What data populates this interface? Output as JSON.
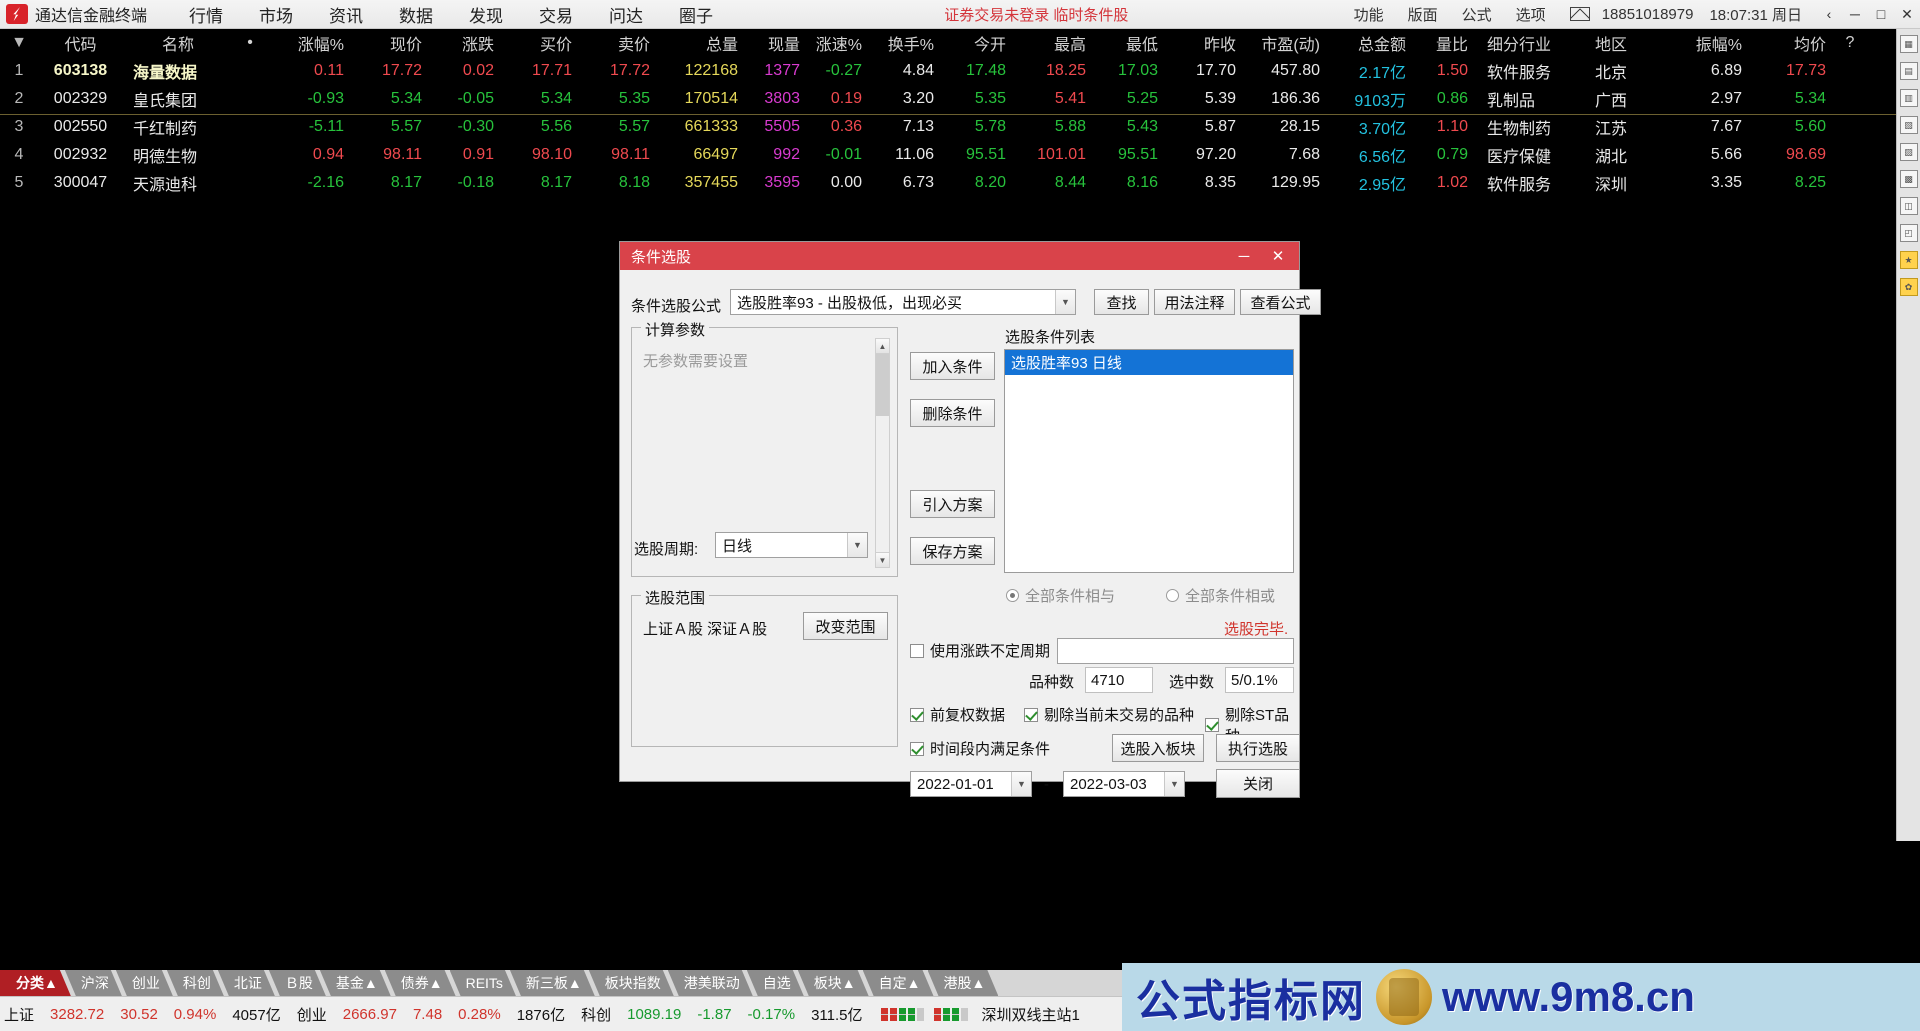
{
  "topbar": {
    "brand": "通达信金融终端",
    "menus": [
      "行情",
      "市场",
      "资讯",
      "数据",
      "发现",
      "交易",
      "问达",
      "圈子"
    ],
    "login_status": "证券交易未登录 临时条件股",
    "right_menus": [
      "功能",
      "版面",
      "公式",
      "选项"
    ],
    "mail_icon": "mail-icon",
    "phone": "18851018979",
    "clock": "18:07:31 周日",
    "win_prev": "‹",
    "win_min": "─",
    "win_max": "□",
    "win_close": "✕"
  },
  "table": {
    "columns": [
      "▼",
      "代码",
      "名称",
      "•",
      "涨幅%",
      "现价",
      "涨跌",
      "买价",
      "卖价",
      "总量",
      "现量",
      "涨速%",
      "换手%",
      "今开",
      "最高",
      "最低",
      "昨收",
      "市盈(动)",
      "总金额",
      "量比",
      "细分行业",
      "地区",
      "振幅%",
      "均价",
      "?"
    ],
    "rows": [
      {
        "idx": "1",
        "code": "603138",
        "name": "海量数据",
        "dot": "",
        "chg": "0.11",
        "price": "17.72",
        "delta": "0.02",
        "buy": "17.71",
        "sell": "17.72",
        "vol": "122168",
        "now": "1377",
        "spd": "-0.27",
        "turn": "4.84",
        "open": "17.48",
        "high": "18.25",
        "low": "17.03",
        "close": "17.70",
        "pe": "457.80",
        "amt": "2.17亿",
        "ratio": "1.50",
        "ind": "软件服务",
        "reg": "北京",
        "amp": "6.89",
        "avg": "17.73"
      },
      {
        "idx": "2",
        "code": "002329",
        "name": "皇氏集团",
        "dot": "",
        "chg": "-0.93",
        "price": "5.34",
        "delta": "-0.05",
        "buy": "5.34",
        "sell": "5.35",
        "vol": "170514",
        "now": "3803",
        "spd": "0.19",
        "turn": "3.20",
        "open": "5.35",
        "high": "5.41",
        "low": "5.25",
        "close": "5.39",
        "pe": "186.36",
        "amt": "9103万",
        "ratio": "0.86",
        "ind": "乳制品",
        "reg": "广西",
        "amp": "2.97",
        "avg": "5.34"
      },
      {
        "idx": "3",
        "code": "002550",
        "name": "千红制药",
        "dot": "",
        "chg": "-5.11",
        "price": "5.57",
        "delta": "-0.30",
        "buy": "5.56",
        "sell": "5.57",
        "vol": "661333",
        "now": "5505",
        "spd": "0.36",
        "turn": "7.13",
        "open": "5.78",
        "high": "5.88",
        "low": "5.43",
        "close": "5.87",
        "pe": "28.15",
        "amt": "3.70亿",
        "ratio": "1.10",
        "ind": "生物制药",
        "reg": "江苏",
        "amp": "7.67",
        "avg": "5.60"
      },
      {
        "idx": "4",
        "code": "002932",
        "name": "明德生物",
        "dot": "",
        "chg": "0.94",
        "price": "98.11",
        "delta": "0.91",
        "buy": "98.10",
        "sell": "98.11",
        "vol": "66497",
        "now": "992",
        "spd": "-0.01",
        "turn": "11.06",
        "open": "95.51",
        "high": "101.01",
        "low": "95.51",
        "close": "97.20",
        "pe": "7.68",
        "amt": "6.56亿",
        "ratio": "0.79",
        "ind": "医疗保健",
        "reg": "湖北",
        "amp": "5.66",
        "avg": "98.69"
      },
      {
        "idx": "5",
        "code": "300047",
        "name": "天源迪科",
        "dot": "",
        "chg": "-2.16",
        "price": "8.17",
        "delta": "-0.18",
        "buy": "8.17",
        "sell": "8.18",
        "vol": "357455",
        "now": "3595",
        "spd": "0.00",
        "turn": "6.73",
        "open": "8.20",
        "high": "8.44",
        "low": "8.16",
        "close": "8.35",
        "pe": "129.95",
        "amt": "2.95亿",
        "ratio": "1.02",
        "ind": "软件服务",
        "reg": "深圳",
        "amp": "3.35",
        "avg": "8.25"
      }
    ]
  },
  "dialog": {
    "title": "条件选股",
    "formula_label": "条件选股公式",
    "formula_value": "选股胜率93  - 出股极低，出现必买",
    "btn_find": "查找",
    "btn_usage": "用法注释",
    "btn_view": "查看公式",
    "param_group_title": "计算参数",
    "param_empty": "无参数需要设置",
    "cycle_label": "选股周期:",
    "cycle_value": "日线",
    "range_group_title": "选股范围",
    "range_value": "上证Ａ股 深证Ａ股",
    "btn_change_range": "改变范围",
    "btn_add_cond": "加入条件",
    "btn_del_cond": "删除条件",
    "btn_import_plan": "引入方案",
    "btn_save_plan": "保存方案",
    "cond_list_title": "选股条件列表",
    "cond_items": [
      "选股胜率93  日线"
    ],
    "radio_and": "全部条件相与",
    "radio_or": "全部条件相或",
    "radio_selected": "and",
    "status_done": "选股完毕.",
    "chk_updown_label": "使用涨跌不定周期",
    "chk_updown_checked": false,
    "updown_value": "",
    "count_label": "品种数",
    "count_value": "4710",
    "selected_label": "选中数",
    "selected_value": "5/0.1%",
    "chk_adjust_label": "前复权数据",
    "chk_adjust_checked": true,
    "chk_notrade_label": "剔除当前未交易的品种",
    "chk_notrade_checked": true,
    "chk_st_label": "剔除ST品种",
    "chk_st_checked": true,
    "chk_period_label": "时间段内满足条件",
    "chk_period_checked": true,
    "date_from": "2022-01-01",
    "date_to": "2022-03-03",
    "date_sep": "-",
    "btn_to_block": "选股入板块",
    "btn_execute": "执行选股",
    "btn_close": "关闭"
  },
  "bottom": {
    "tabs": [
      "分类▲",
      "沪深",
      "创业",
      "科创",
      "北证",
      "Ｂ股",
      "基金▲",
      "债券▲",
      "REITs",
      "新三板▲",
      "板块指数",
      "港美联动",
      "自选",
      "板块▲",
      "自定▲",
      "港股▲"
    ],
    "active_tab": 0,
    "status": [
      {
        "k": "上证",
        "v": "3282.72",
        "d": "30.52",
        "p": "0.94%",
        "a": "4057亿",
        "color": "#d0342c"
      },
      {
        "k": "创业",
        "v": "2666.97",
        "d": "7.48",
        "p": "0.28%",
        "a": "1876亿",
        "color": "#d0342c"
      },
      {
        "k": "科创",
        "v": "1089.19",
        "d": "-1.87",
        "p": "-0.17%",
        "a": "311.5亿",
        "color": "#179a2e"
      }
    ],
    "server": "深圳双线主站1"
  },
  "watermark": {
    "text": "公式指标网",
    "url": "www.9m8.cn",
    "coin_icon": "coin-icon"
  },
  "colors": {
    "accent_red": "#d9434a",
    "up": "#f04a4f",
    "down": "#27c23c",
    "select_blue": "#1473d6"
  }
}
